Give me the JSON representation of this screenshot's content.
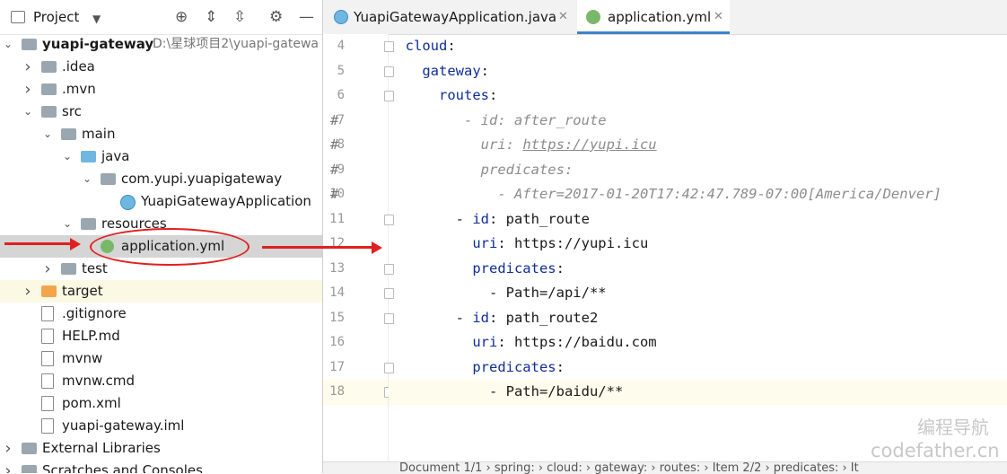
{
  "project": {
    "title": "Project",
    "tree": [
      {
        "label": "yuapi-gateway",
        "path": "D:\\星球项目2\\yuapi-gatewa",
        "level": 0,
        "chev": "v",
        "icon": "folder"
      },
      {
        "label": ".idea",
        "level": 1,
        "chev": ">",
        "icon": "folder"
      },
      {
        "label": ".mvn",
        "level": 1,
        "chev": ">",
        "icon": "folder"
      },
      {
        "label": "src",
        "level": 1,
        "chev": "v",
        "icon": "folder"
      },
      {
        "label": "main",
        "level": 2,
        "chev": "v",
        "icon": "folder"
      },
      {
        "label": "java",
        "level": 3,
        "chev": "v",
        "icon": "folder-blue"
      },
      {
        "label": "com.yupi.yuapigateway",
        "level": 4,
        "chev": "v",
        "icon": "package"
      },
      {
        "label": "YuapiGatewayApplication",
        "level": 5,
        "chev": "",
        "icon": "class"
      },
      {
        "label": "resources",
        "level": 3,
        "chev": "v",
        "icon": "folder"
      },
      {
        "label": "application.yml",
        "level": 4,
        "chev": "",
        "icon": "yml",
        "selected": true
      },
      {
        "label": "test",
        "level": 2,
        "chev": ">",
        "icon": "folder"
      },
      {
        "label": "target",
        "level": 1,
        "chev": ">",
        "icon": "folder-orange",
        "highlight": true
      },
      {
        "label": ".gitignore",
        "level": 1,
        "chev": "",
        "icon": "file"
      },
      {
        "label": "HELP.md",
        "level": 1,
        "chev": "",
        "icon": "file"
      },
      {
        "label": "mvnw",
        "level": 1,
        "chev": "",
        "icon": "file"
      },
      {
        "label": "mvnw.cmd",
        "level": 1,
        "chev": "",
        "icon": "file"
      },
      {
        "label": "pom.xml",
        "level": 1,
        "chev": "",
        "icon": "file"
      },
      {
        "label": "yuapi-gateway.iml",
        "level": 1,
        "chev": "",
        "icon": "file"
      },
      {
        "label": "External Libraries",
        "level": 0,
        "chev": ">",
        "icon": "library"
      },
      {
        "label": "Scratches and Consoles",
        "level": 0,
        "chev": ">",
        "icon": "scratch"
      }
    ]
  },
  "editor": {
    "tabs": [
      {
        "label": "YuapiGatewayApplication.java",
        "active": false,
        "icon": "class-icon"
      },
      {
        "label": "application.yml",
        "active": true,
        "icon": "yml-icon"
      }
    ],
    "lines": [
      {
        "n": "4",
        "hash": "",
        "segs": [
          [
            "key",
            "  cloud"
          ],
          [
            "val",
            ":"
          ]
        ]
      },
      {
        "n": "5",
        "hash": "",
        "segs": [
          [
            "key",
            "    gateway"
          ],
          [
            "val",
            ":"
          ]
        ]
      },
      {
        "n": "6",
        "hash": "",
        "segs": [
          [
            "key",
            "      routes"
          ],
          [
            "val",
            ":"
          ]
        ]
      },
      {
        "n": "7",
        "hash": "#",
        "segs": [
          [
            "cmt",
            "         - id: after_route"
          ]
        ]
      },
      {
        "n": "8",
        "hash": "#",
        "segs": [
          [
            "cmt",
            "           uri: "
          ],
          [
            "cmt-u",
            "https://yupi.icu"
          ]
        ]
      },
      {
        "n": "9",
        "hash": "#",
        "segs": [
          [
            "cmt",
            "           predicates:"
          ]
        ]
      },
      {
        "n": "10",
        "hash": "#",
        "segs": [
          [
            "cmt",
            "             - After=2017-01-20T17:42:47.789-07:00[America/Denver]"
          ]
        ]
      },
      {
        "n": "11",
        "hash": "",
        "segs": [
          [
            "val",
            "        - "
          ],
          [
            "key",
            "id"
          ],
          [
            "val",
            ": path_route"
          ]
        ]
      },
      {
        "n": "12",
        "hash": "",
        "segs": [
          [
            "key",
            "          uri"
          ],
          [
            "val",
            ": https://yupi.icu"
          ]
        ]
      },
      {
        "n": "13",
        "hash": "",
        "segs": [
          [
            "key",
            "          predicates"
          ],
          [
            "val",
            ":"
          ]
        ]
      },
      {
        "n": "14",
        "hash": "",
        "segs": [
          [
            "val",
            "            - Path=/api/**"
          ]
        ]
      },
      {
        "n": "15",
        "hash": "",
        "segs": [
          [
            "val",
            "        - "
          ],
          [
            "key",
            "id"
          ],
          [
            "val",
            ": path_route2"
          ]
        ]
      },
      {
        "n": "16",
        "hash": "",
        "segs": [
          [
            "key",
            "          uri"
          ],
          [
            "val",
            ": https://baidu.com"
          ]
        ]
      },
      {
        "n": "17",
        "hash": "",
        "segs": [
          [
            "key",
            "          predicates"
          ],
          [
            "val",
            ":"
          ]
        ]
      },
      {
        "n": "18",
        "hash": "",
        "segs": [
          [
            "val",
            "            - Path=/baidu/**"
          ]
        ],
        "current": true
      }
    ],
    "breadcrumb": "Document 1/1  ›  spring:  ›  cloud:  ›  gateway:  ›  routes:  ›  Item 2/2  ›  predicates:  ›  It"
  },
  "watermark": {
    "line1": "编程导航",
    "line2": "codefather.cn"
  },
  "colors": {
    "annotation": "#e02020",
    "accent": "#4083c9"
  }
}
